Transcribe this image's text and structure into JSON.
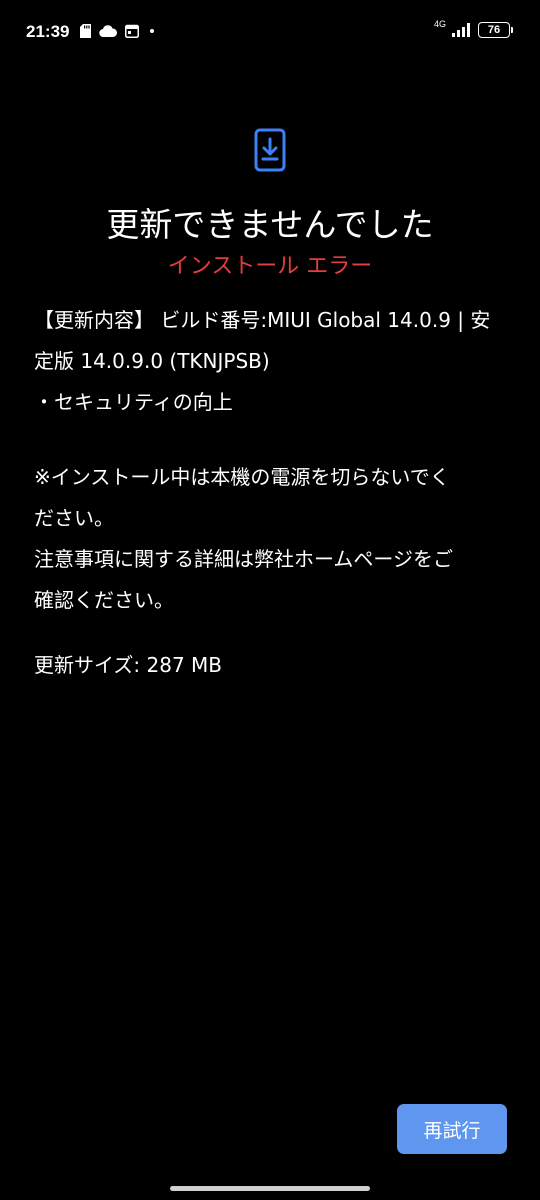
{
  "status_bar": {
    "time": "21:39",
    "network_type": "4G",
    "battery_level": "76",
    "icons_left": [
      "sd-card-icon",
      "cloud-icon",
      "calendar-icon",
      "dot-icon"
    ],
    "icons_right": [
      "signal-icon",
      "battery-icon"
    ]
  },
  "update": {
    "icon": "phone-download-icon",
    "title": "更新できませんでした",
    "error": "インストール エラー",
    "changelog_line1": "【更新内容】 ビルド番号:MIUI Global 14.0.9 | 安",
    "changelog_line2": "定版 14.0.9.0 (TKNJPSB)",
    "changelog_item": "・セキュリティの向上",
    "notice_line1": "※インストール中は本機の電源を切らないでく",
    "notice_line2": "ださい。",
    "notice_line3": "注意事項に関する詳細は弊社ホームページをご",
    "notice_line4": "確認ください。",
    "size_label": "更新サイズ: 287 MB"
  },
  "actions": {
    "retry_label": "再試行"
  },
  "colors": {
    "background": "#000000",
    "error_red": "#e53d3d",
    "accent_blue": "#5f97f0",
    "icon_blue": "#3b82f6"
  }
}
